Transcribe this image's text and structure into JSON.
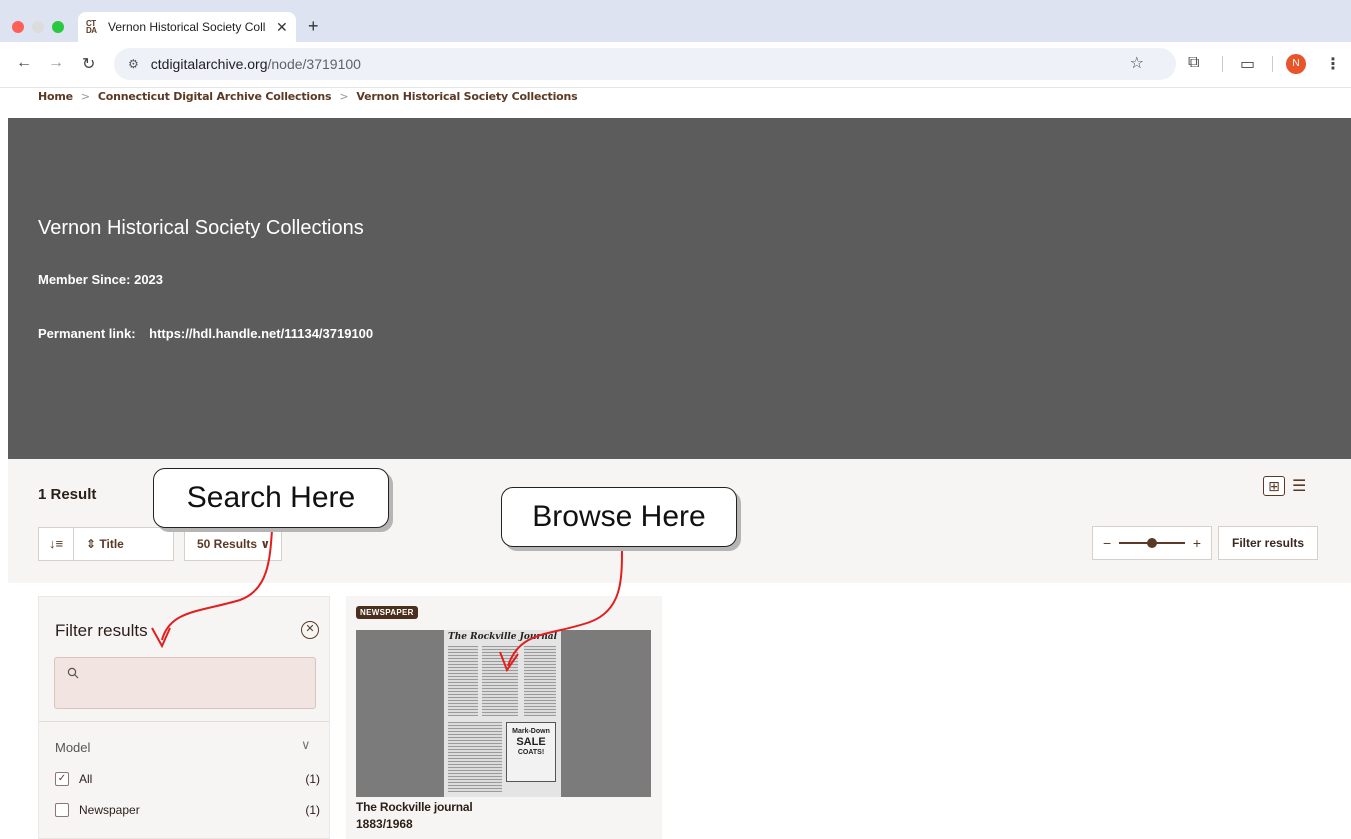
{
  "browser": {
    "tab_title": "Vernon Historical Society Coll",
    "favicon_text": "CT DA",
    "close_glyph": "✕",
    "new_tab_glyph": "+",
    "url_host": "ctdigitalarchive.org",
    "url_path": "/node/3719100",
    "avatar_letter": "N",
    "colors": {
      "tabstrip": "#dde3f0",
      "avatar": "#e8552a"
    }
  },
  "breadcrumb": {
    "items": [
      "Home",
      "Connecticut Digital Archive Collections",
      "Vernon Historical Society Collections"
    ],
    "separator": ">"
  },
  "hero": {
    "title": "Vernon Historical Society Collections",
    "member_since": "Member Since: 2023",
    "permalink_label": "Permanent link:",
    "permalink_url": "https://hdl.handle.net/11134/3719100",
    "background": "#5c5c5c"
  },
  "results": {
    "count": "1 Result",
    "sort_field": "Title",
    "per_page": "50 Results",
    "filter_button": "Filter results",
    "zoom_minus": "−",
    "zoom_plus": "+",
    "zoom_level": 0.5
  },
  "sidebar": {
    "title": "Filter results",
    "search_value": "",
    "search_placeholder": "",
    "facet_group": "Model",
    "facets": [
      {
        "label": "All",
        "count": "(1)",
        "checked": true
      },
      {
        "label": "Newspaper",
        "count": "(1)",
        "checked": false
      }
    ]
  },
  "card": {
    "badge": "NEWSPAPER",
    "title": "The Rockville journal",
    "date": "1883/1968",
    "thumb_masthead": "The Rockville Journal",
    "thumb_ad_line1": "Mark-Down",
    "thumb_ad_line2": "SALE",
    "thumb_ad_line3": "COATS!"
  },
  "annotations": {
    "search_callout": "Search Here",
    "browse_callout": "Browse Here",
    "arrow_color": "#e02020"
  },
  "icons": {
    "back": "back-arrow-icon",
    "forward": "forward-arrow-icon",
    "reload": "reload-icon",
    "star": "bookmark-star-icon",
    "extensions": "extensions-icon",
    "cast": "cast-icon",
    "menu": "kebab-menu-icon",
    "sort": "sort-direction-icon",
    "search": "search-icon",
    "close": "close-circle-icon",
    "chevron": "chevron-down-icon",
    "grid": "grid-view-icon",
    "list": "list-view-icon"
  }
}
